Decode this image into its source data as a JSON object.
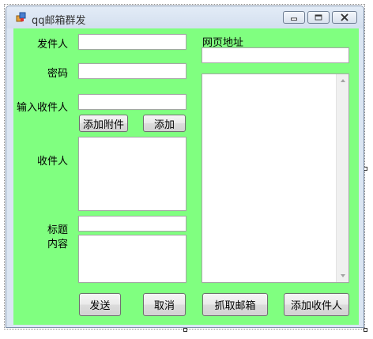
{
  "window": {
    "title": "qq邮箱群发",
    "minimize_icon": "minimize-icon",
    "maximize_icon": "maximize-icon",
    "close_icon": "close-icon",
    "client_bg": "#80ff80"
  },
  "form": {
    "sender_label": "发件人",
    "sender_value": "",
    "password_label": "密码",
    "password_value": "",
    "recipient_input_label": "输入收件人",
    "recipient_input_value": "",
    "add_attachment_label": "添加附件",
    "add_label": "添加",
    "recipients_label": "收件人",
    "recipients_value": "",
    "subject_label": "标题",
    "subject_value": "",
    "content_label": "内容",
    "content_value": "",
    "url_label": "网页地址",
    "url_value": "",
    "page_text_value": "",
    "send_label": "发送",
    "cancel_label": "取消",
    "fetch_email_label": "抓取邮箱",
    "add_recipient_label": "添加收件人"
  }
}
